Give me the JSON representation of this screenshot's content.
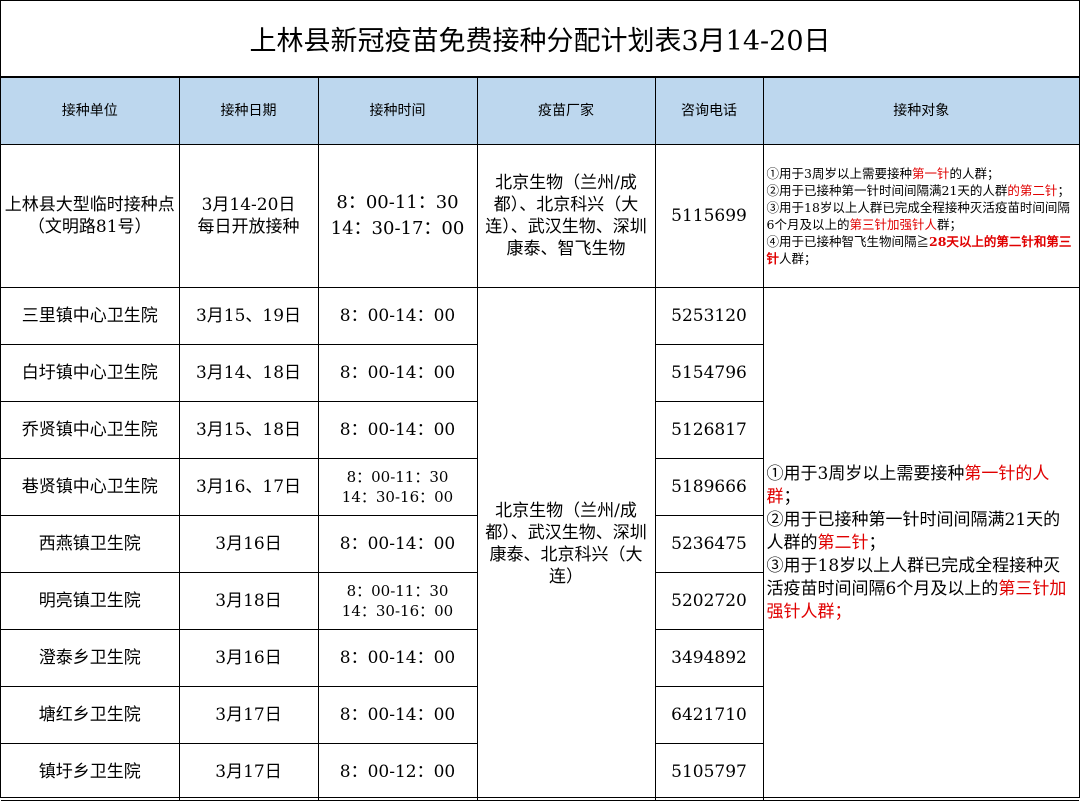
{
  "title": "上林县新冠疫苗免费接种分配计划表3月14-20日",
  "headers": [
    "接种单位",
    "接种日期",
    "接种时间",
    "疫苗厂家",
    "咨询电话",
    "接种对象"
  ],
  "first_row": {
    "unit_line1": "上林县大型临时接种点",
    "unit_line2": "（文明路81号）",
    "date_line1": "3月14-20日",
    "date_line2": "每日开放接种",
    "time_line1": "8：00-11：30",
    "time_line2": "14：30-17：00",
    "vendor": "北京生物（兰州/成都）、北京科兴（大连）、武汉生物、深圳康泰、智飞生物",
    "phone": "5115699",
    "target": {
      "i1_a": "①用于3周岁以上需要接种",
      "i1_b": "第一针",
      "i1_c": "的人群；",
      "i2_a": "②用于已接种第一针时间间隔满21天的人群",
      "i2_b": "的第二针",
      "i2_c": "；",
      "i3_a": "③用于18岁以上人群已完成全程接种灭活疫苗时间间隔6个月及以上的",
      "i3_b": "第三针加强针人",
      "i3_c": "群；",
      "i4_a": "④用于已接种智飞生物间隔≧",
      "i4_b": "28天以上的第二针和第三针",
      "i4_c": "人群；"
    }
  },
  "rows": [
    {
      "unit": "三里镇中心卫生院",
      "date": "3月15、19日",
      "time1": "8：00-14：00",
      "time2": "",
      "phone": "5253120"
    },
    {
      "unit": "白圩镇中心卫生院",
      "date": "3月14、18日",
      "time1": "8：00-14：00",
      "time2": "",
      "phone": "5154796"
    },
    {
      "unit": "乔贤镇中心卫生院",
      "date": "3月15、18日",
      "time1": "8：00-14：00",
      "time2": "",
      "phone": "5126817"
    },
    {
      "unit": "巷贤镇中心卫生院",
      "date": "3月16、17日",
      "time1": "8：00-11：30",
      "time2": "14：30-16：00",
      "phone": "5189666"
    },
    {
      "unit": "西燕镇卫生院",
      "date": "3月16日",
      "time1": "8：00-14：00",
      "time2": "",
      "phone": "5236475"
    },
    {
      "unit": "明亮镇卫生院",
      "date": "3月18日",
      "time1": "8：00-11：30",
      "time2": "14：30-16：00",
      "phone": "5202720"
    },
    {
      "unit": "澄泰乡卫生院",
      "date": "3月16日",
      "time1": "8：00-14：00",
      "time2": "",
      "phone": "3494892"
    },
    {
      "unit": "塘红乡卫生院",
      "date": "3月17日",
      "time1": "8：00-14：00",
      "time2": "",
      "phone": "6421710"
    },
    {
      "unit": "镇圩乡卫生院",
      "date": "3月17日",
      "time1": "8：00-12：00",
      "time2": "",
      "phone": "5105797"
    }
  ],
  "group_vendor": "北京生物（兰州/成都）、武汉生物、深圳康泰、北京科兴（大连）",
  "group_target": {
    "i1_a": "①用于3周岁以上需要接种",
    "i1_b": "第一针的人群",
    "i1_c": "；",
    "i2_a": "②用于已接种第一针时间间隔满21天的人群的",
    "i2_b": "第二针",
    "i2_c": "；",
    "i3_a": "③用于18岁以上人群已完成全程接种灭活疫苗时间间隔6个月及以上的",
    "i3_b": "第三针加强针人群；"
  },
  "colors": {
    "header_bg": "#bdd7ee",
    "highlight": "#e00000"
  }
}
